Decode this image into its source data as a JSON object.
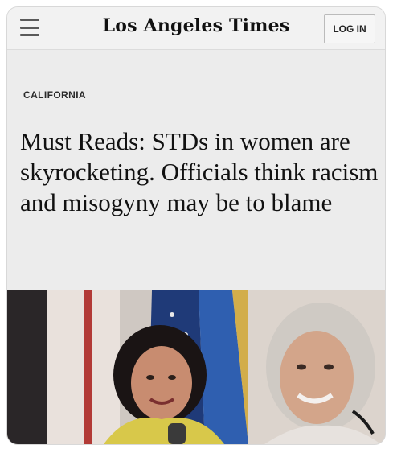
{
  "header": {
    "menu_icon": "hamburger-menu-icon",
    "masthead": "Los Angeles Times",
    "login_label": "LOG IN"
  },
  "article": {
    "section": "CALIFORNIA",
    "headline": "Must Reads: STDs in women are skyrocketing. Officials think racism and misogyny may be to blame"
  }
}
